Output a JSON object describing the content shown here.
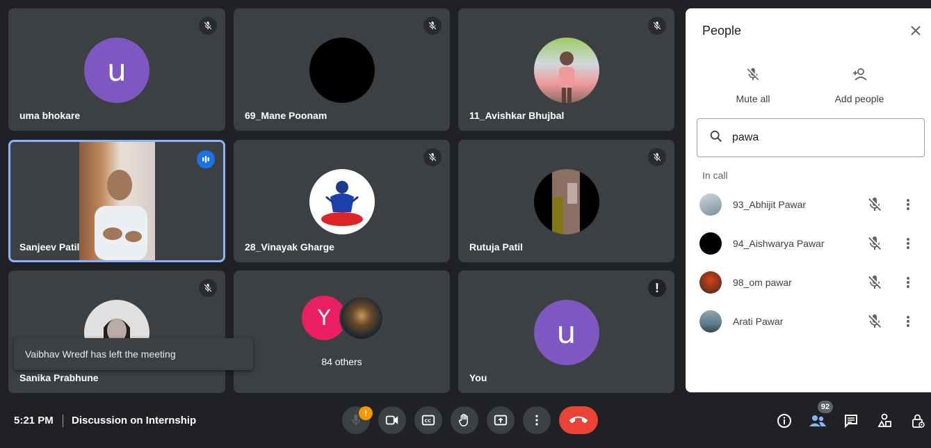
{
  "tiles": [
    {
      "name": "uma bhokare",
      "initial": "u",
      "color": "#7e57c2"
    },
    {
      "name": "69_Mane Poonam",
      "color": "#000000"
    },
    {
      "name": "11_Avishkar Bhujbal",
      "color": "#cfd8dc"
    },
    {
      "name": "Sanjeev Patil"
    },
    {
      "name": "28_Vinayak Gharge",
      "color": "#ffffff"
    },
    {
      "name": "Rutuja Patil",
      "color": "#000000"
    },
    {
      "name": "Sanika Prabhune",
      "color": "#e0e0e0"
    },
    {
      "name": "84 others",
      "initial": "Y",
      "color": "#e91e63"
    },
    {
      "name": "You",
      "initial": "u",
      "color": "#7e57c2"
    }
  ],
  "toast": "Vaibhav Wredf has left the meeting",
  "panel": {
    "title": "People",
    "mute_all": "Mute all",
    "add_people": "Add people",
    "search_value": "pawa",
    "section": "In call",
    "people": [
      {
        "name": "93_Abhijit Pawar",
        "color": "#90a4ae"
      },
      {
        "name": "94_Aishwarya Pawar",
        "color": "#000000"
      },
      {
        "name": "98_om pawar",
        "color": "#8d4a3a"
      },
      {
        "name": "Arati Pawar",
        "color": "#78909c"
      }
    ]
  },
  "bottom": {
    "time": "5:21 PM",
    "meeting": "Discussion on Internship",
    "warn": "!",
    "people_count": "92"
  }
}
